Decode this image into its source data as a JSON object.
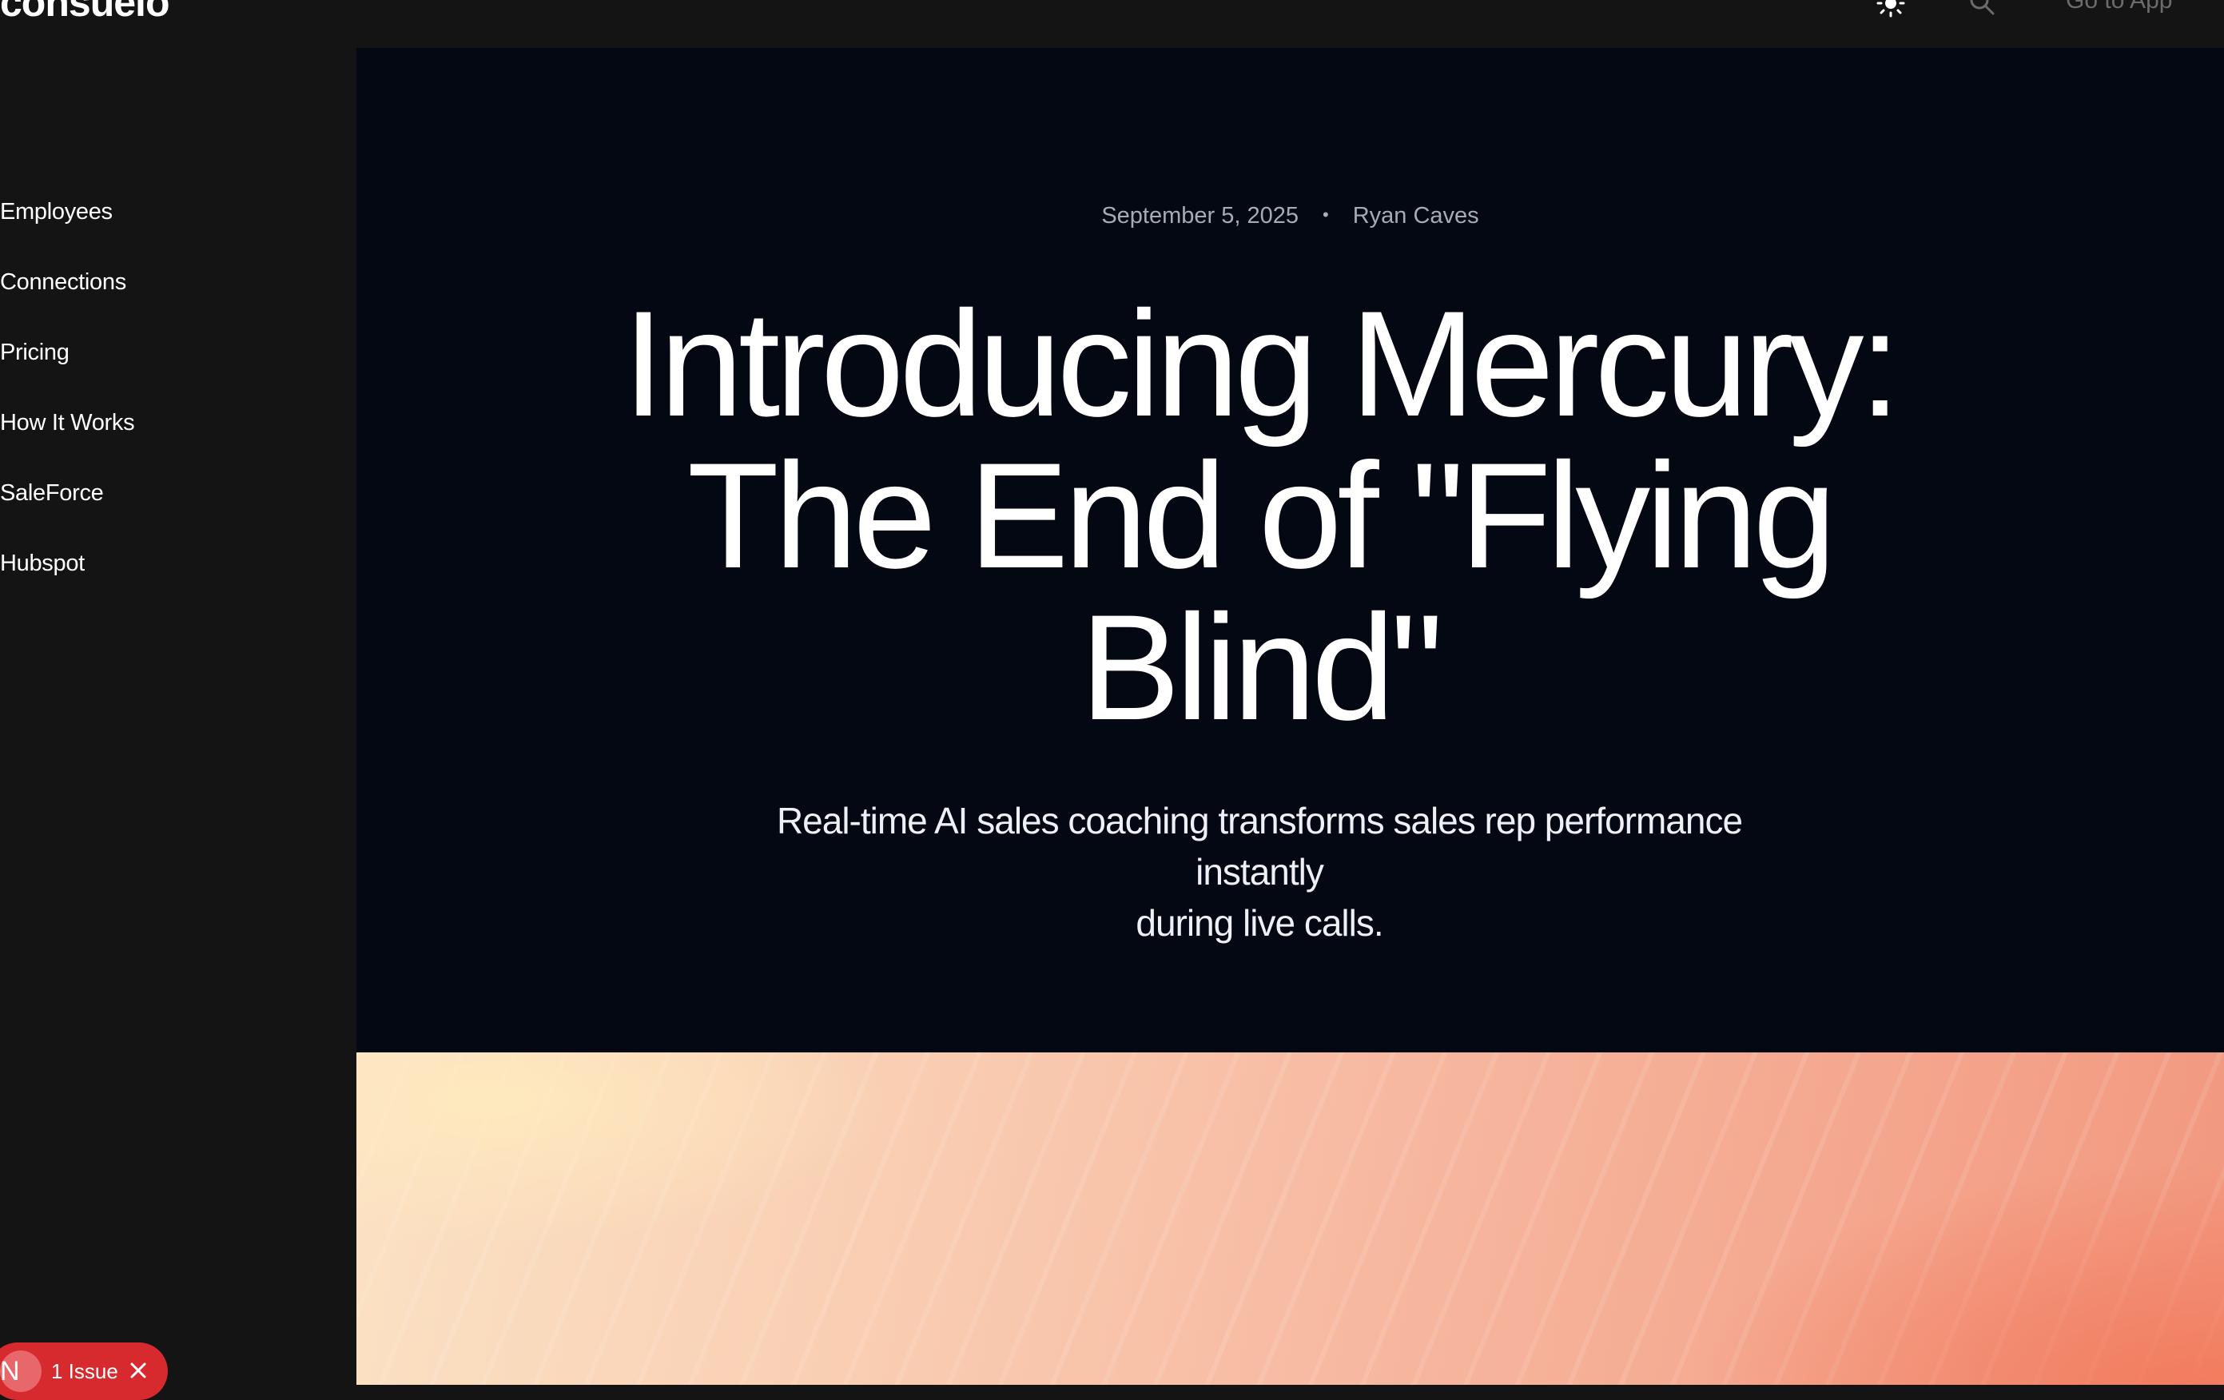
{
  "header": {
    "logo_text": "consuelo",
    "theme_icon": "sun-icon",
    "search_icon": "search-icon",
    "cta_label": "Go to App"
  },
  "sidebar": {
    "items": [
      {
        "label": "Employees"
      },
      {
        "label": "Connections"
      },
      {
        "label": "Pricing"
      },
      {
        "label": "How It Works"
      },
      {
        "label": "SaleForce"
      },
      {
        "label": "Hubspot"
      }
    ]
  },
  "article": {
    "date": "September 5, 2025",
    "separator": "•",
    "author": "Ryan Caves",
    "title_lines": [
      "Introducing Mercury:",
      "The End of \"Flying",
      "Blind\""
    ],
    "subtitle_lines": [
      "Real-time AI sales coaching transforms sales rep performance instantly",
      "during live calls."
    ]
  },
  "issues_badge": {
    "avatar_letter": "N",
    "label": "1 Issue",
    "close_icon": "close-icon",
    "color": "#d62a2f"
  },
  "colors": {
    "sidebar_bg": "#141414",
    "main_bg": "#040812",
    "meta_text": "#a6abb6"
  }
}
